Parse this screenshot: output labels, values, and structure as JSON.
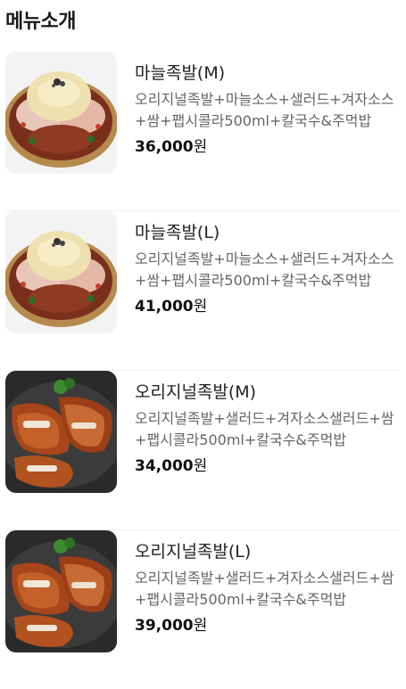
{
  "section": {
    "title": "메뉴소개"
  },
  "menu": [
    {
      "name": "마늘족발(M)",
      "description": "오리지널족발+마늘소스+샐러드+겨자소스+쌈+팹시콜라500ml+칼국수&주먹밥",
      "price": "36,000",
      "currency": "원",
      "image": "garlic-jokbal-image"
    },
    {
      "name": "마늘족발(L)",
      "description": "오리지널족발+마늘소스+샐러드+겨자소스+쌈+팹시콜라500ml+칼국수&주먹밥",
      "price": "41,000",
      "currency": "원",
      "image": "garlic-jokbal-image"
    },
    {
      "name": "오리지널족발(M)",
      "description": "오리지널족발+샐러드+겨자소스샐러드+쌈+팹시콜라500ml+칼국수&주먹밥",
      "price": "34,000",
      "currency": "원",
      "image": "original-jokbal-image"
    },
    {
      "name": "오리지널족발(L)",
      "description": "오리지널족발+샐러드+겨자소스샐러드+쌈+팹시콜라500ml+칼국수&주먹밥",
      "price": "39,000",
      "currency": "원",
      "image": "original-jokbal-image"
    }
  ],
  "colors": {
    "text_primary": "#222222",
    "text_secondary": "#666666",
    "divider": "#eeeeee"
  }
}
